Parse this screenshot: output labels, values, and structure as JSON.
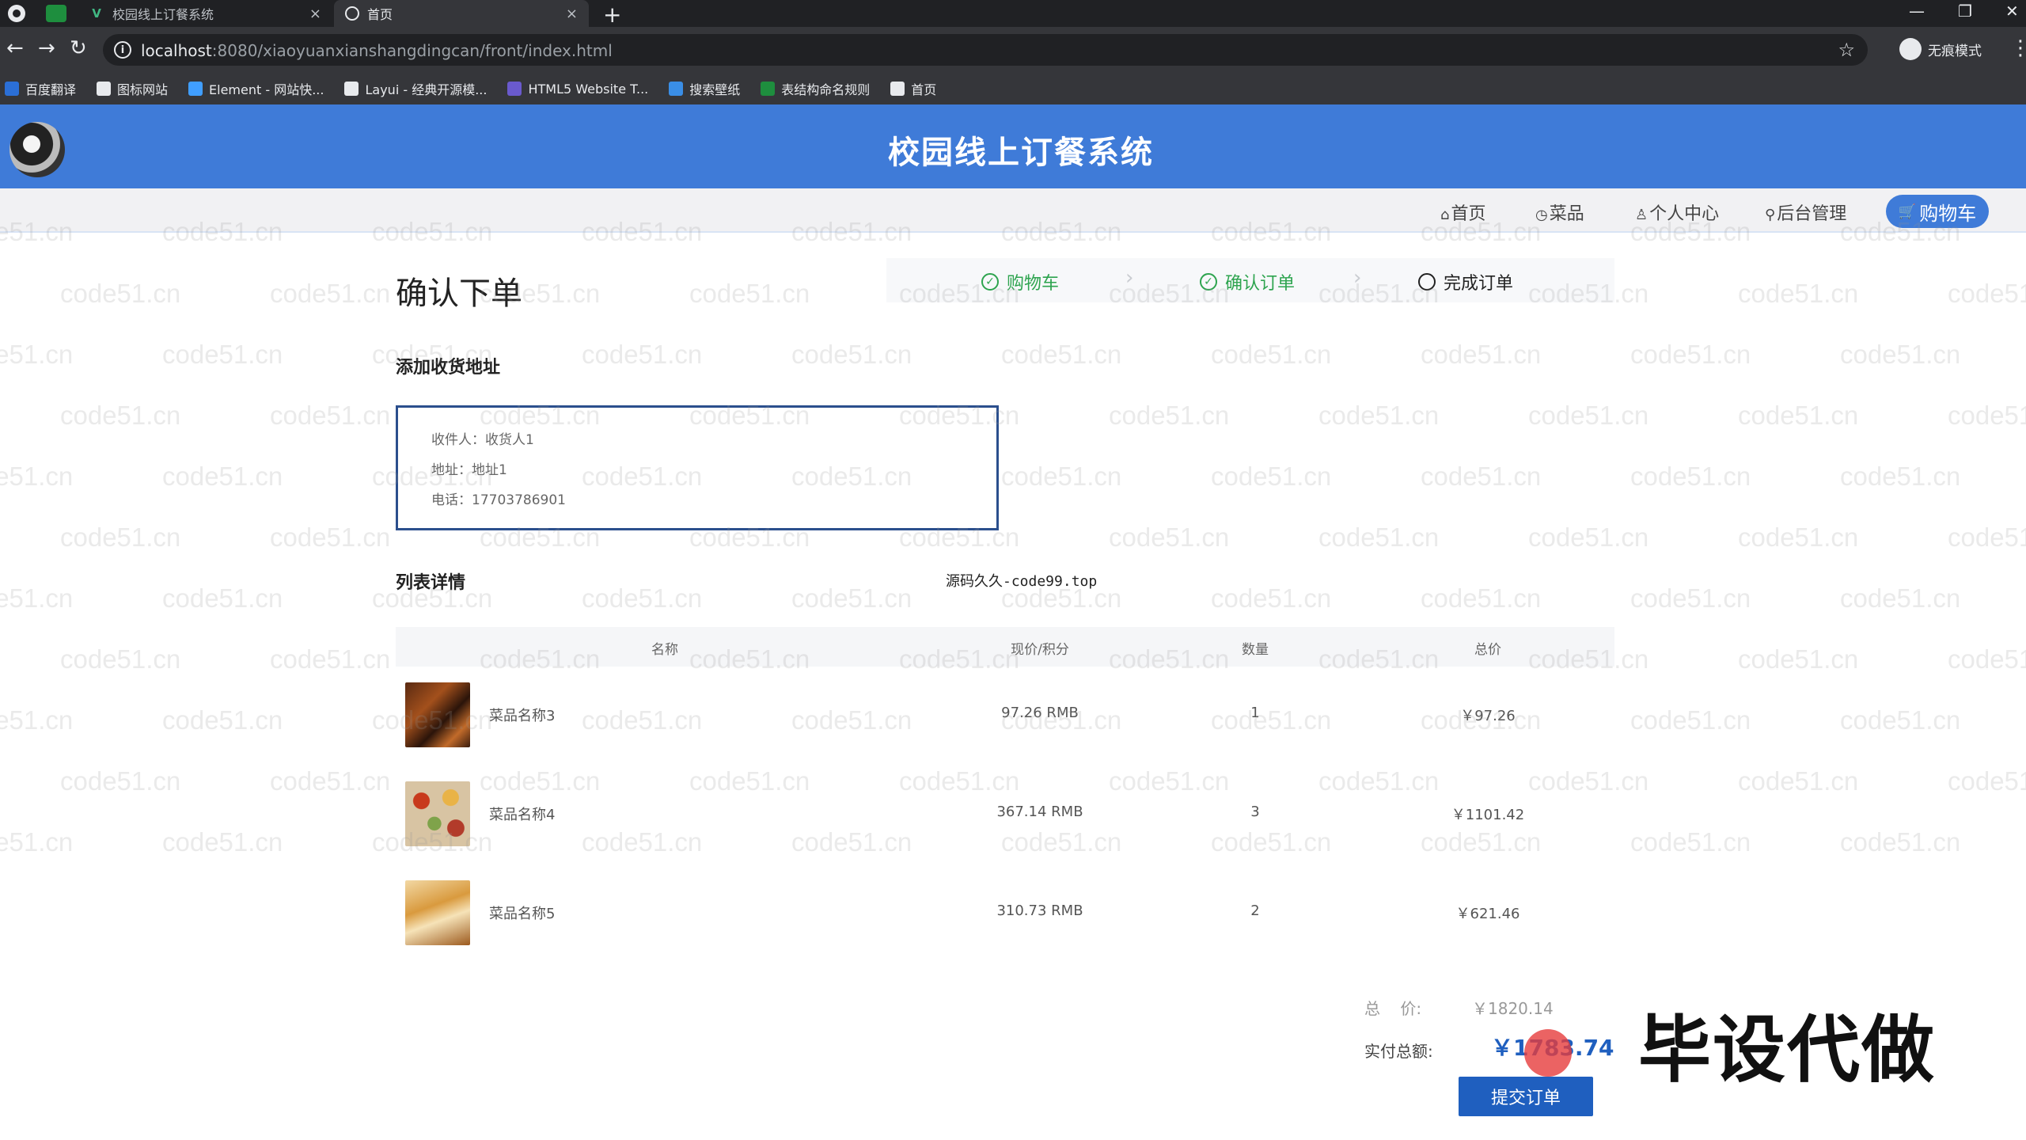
{
  "browser": {
    "tabs": [
      {
        "title": "校园线上订餐系统",
        "close": "×"
      },
      {
        "title": "首页",
        "close": "×"
      }
    ],
    "new_tab": "+",
    "window_controls": {
      "minimize": "—",
      "restore": "❐",
      "close": "✕"
    },
    "nav": {
      "back": "←",
      "forward": "→",
      "reload": "↻"
    },
    "url_host": "localhost",
    "url_rest": ":8080/xiaoyuanxianshangdingcan/front/index.html",
    "bookmark_star": "☆",
    "incognito_label": "无痕模式",
    "menu": "⋮",
    "bookmarks": [
      {
        "label": "百度翻译",
        "icon": "baidu-translate-icon",
        "color": "#2b6fd6"
      },
      {
        "label": "图标网站",
        "icon": "flag-icon",
        "color": "#e8eaed"
      },
      {
        "label": "Element - 网站快...",
        "icon": "element-icon",
        "color": "#409eff"
      },
      {
        "label": "Layui - 经典开源模...",
        "icon": "layui-icon",
        "color": "#e8eaed"
      },
      {
        "label": "HTML5 Website T...",
        "icon": "html5-icon",
        "color": "#6a5acd"
      },
      {
        "label": "搜索壁纸",
        "icon": "wallpaper-icon",
        "color": "#3a8ee6"
      },
      {
        "label": "表结构命名规则",
        "icon": "table-icon",
        "color": "#1e8e3e"
      },
      {
        "label": "首页",
        "icon": "globe-icon",
        "color": "#e8eaed"
      }
    ]
  },
  "site": {
    "title": "校园线上订餐系统",
    "nav": [
      {
        "label": "首页",
        "icon": "home-icon",
        "glyph": "⌂"
      },
      {
        "label": "菜品",
        "icon": "dish-icon",
        "glyph": "◷"
      },
      {
        "label": "个人中心",
        "icon": "user-icon",
        "glyph": "♙"
      },
      {
        "label": "后台管理",
        "icon": "link-icon",
        "glyph": "⚲"
      }
    ],
    "cart_button": {
      "label": "购物车",
      "glyph": "🛒"
    }
  },
  "watermark_text": "code51.cn",
  "checkout": {
    "title": "确认下单",
    "steps": [
      {
        "label": "购物车",
        "state": "done",
        "glyph": "✓"
      },
      {
        "label": "确认订单",
        "state": "done",
        "glyph": "✓"
      },
      {
        "label": "完成订单",
        "state": "current",
        "glyph": ""
      }
    ],
    "step_separator": "›",
    "address_heading": "添加收货地址",
    "address": {
      "receiver": "收件人：收货人1",
      "addr": "地址：地址1",
      "phone": "电话：17703786901"
    },
    "list_heading": "列表详情",
    "source_note": "源码久久-code99.top",
    "columns": [
      "名称",
      "现价/积分",
      "数量",
      "总价"
    ],
    "items": [
      {
        "name": "菜品名称3",
        "price": "97.26 RMB",
        "qty": "1",
        "total": "￥97.26"
      },
      {
        "name": "菜品名称4",
        "price": "367.14 RMB",
        "qty": "3",
        "total": "￥1101.42"
      },
      {
        "name": "菜品名称5",
        "price": "310.73 RMB",
        "qty": "2",
        "total": "￥621.46"
      }
    ],
    "total_label": "总    价:",
    "total_value": "￥1820.14",
    "pay_label": "实付总额:",
    "pay_value": "￥1783.74",
    "submit_label": "提交订单"
  },
  "overlay_stamp": "毕设代做"
}
